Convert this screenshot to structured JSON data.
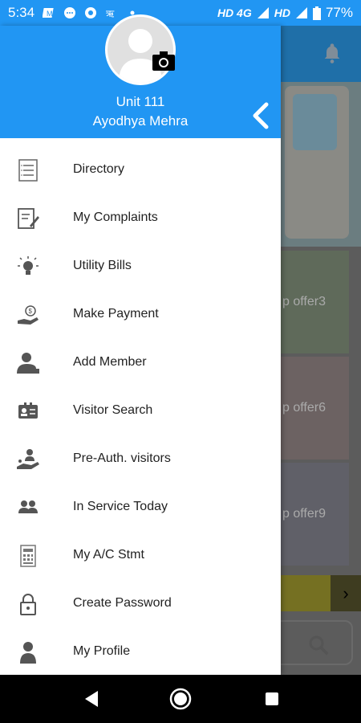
{
  "status_bar": {
    "time": "5:34",
    "network_left": "HD 4G",
    "network_right": "HD",
    "battery": "77%"
  },
  "drawer": {
    "unit": "Unit 111",
    "user": "Ayodhya Mehra",
    "items": [
      {
        "label": "Directory",
        "icon": "directory-icon"
      },
      {
        "label": "My Complaints",
        "icon": "complaints-icon"
      },
      {
        "label": "Utility Bills",
        "icon": "lightbulb-icon"
      },
      {
        "label": "Make Payment",
        "icon": "payment-icon"
      },
      {
        "label": "Add Member",
        "icon": "add-member-icon"
      },
      {
        "label": "Visitor Search",
        "icon": "id-card-icon"
      },
      {
        "label": "Pre-Auth. visitors",
        "icon": "pre-auth-icon"
      },
      {
        "label": "In Service Today",
        "icon": "service-people-icon"
      },
      {
        "label": "My A/C Stmt",
        "icon": "statement-icon"
      },
      {
        "label": "Create Password",
        "icon": "lock-icon"
      },
      {
        "label": "My Profile",
        "icon": "profile-icon"
      }
    ]
  },
  "background": {
    "tiles": [
      "p offer3",
      "p offer6",
      "p offer9"
    ]
  },
  "colors": {
    "primary": "#2196f3",
    "icon_gray": "#555555"
  }
}
